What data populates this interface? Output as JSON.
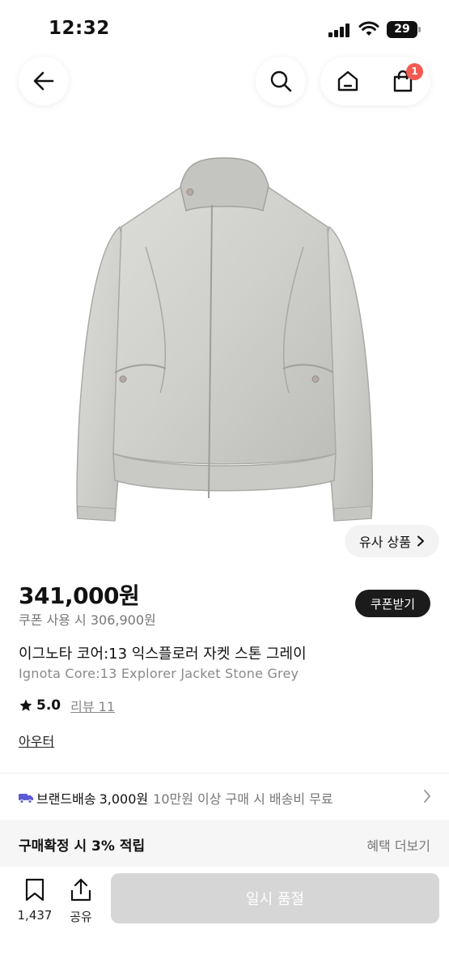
{
  "status_bar": {
    "time": "12:32",
    "battery": "29"
  },
  "nav": {
    "cart_count": "1"
  },
  "product": {
    "similar_label": "유사 상품",
    "price": "341,000원",
    "coupon_price": "쿠폰 사용 시 306,900원",
    "coupon_button": "쿠폰받기",
    "title_ko": "이그노타 코어:13 익스플로러 자켓 스톤 그레이",
    "title_en": "Ignota Core:13 Explorer Jacket Stone Grey",
    "rating": "5.0",
    "review_label": "리뷰 11",
    "category": "아우터"
  },
  "shipping": {
    "label": "브랜드배송",
    "fee": "3,000원",
    "note": "10만원 이상 구매 시 배송비 무료"
  },
  "points": {
    "label": "구매확정 시 3% 적립",
    "benefits_link": "혜택 더보기"
  },
  "bottom_bar": {
    "bookmark_count": "1,437",
    "share_label": "공유",
    "soldout_label": "일시 품절"
  },
  "colors": {
    "badge": "#f25a52",
    "soldout_button": "#d6d6d6",
    "shipping_truck": "#5b5bd6",
    "coupon_button": "#1b1b1b"
  }
}
